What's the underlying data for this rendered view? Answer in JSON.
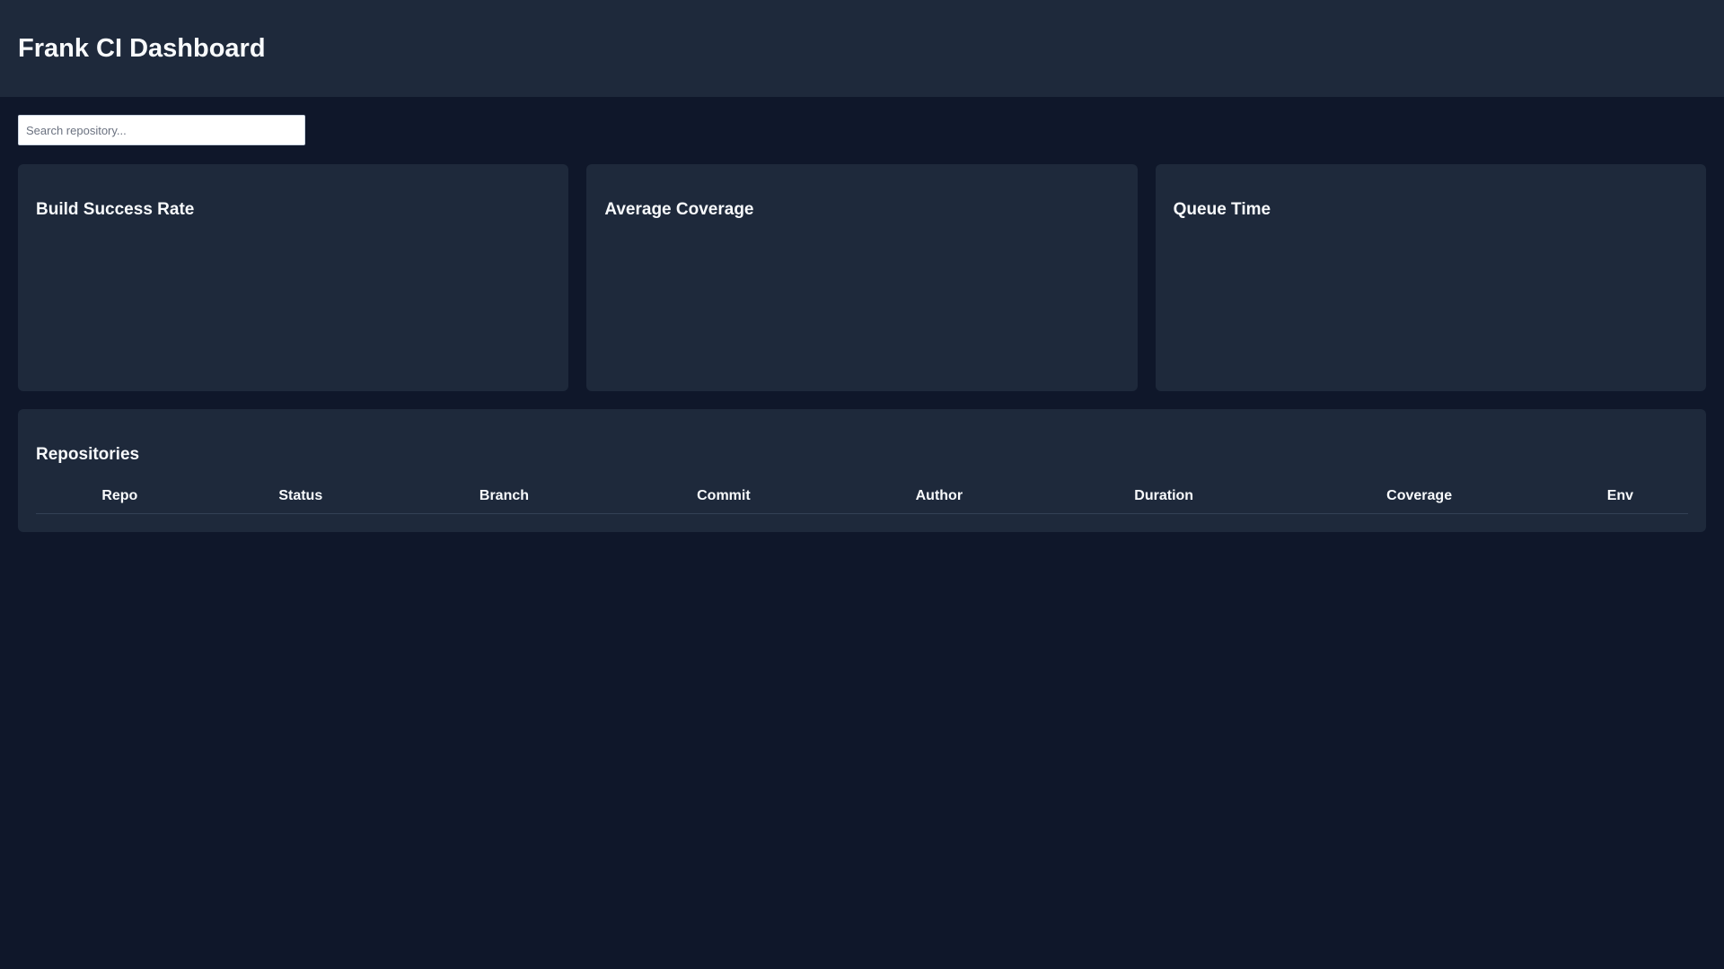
{
  "header": {
    "title": "Frank CI Dashboard"
  },
  "search": {
    "placeholder": "Search repository...",
    "value": ""
  },
  "cards": [
    {
      "title": "Build Success Rate"
    },
    {
      "title": "Average Coverage"
    },
    {
      "title": "Queue Time"
    }
  ],
  "repositories": {
    "title": "Repositories",
    "columns": [
      "Repo",
      "Status",
      "Branch",
      "Commit",
      "Author",
      "Duration",
      "Coverage",
      "Env"
    ]
  },
  "colors": {
    "background": "#0f172a",
    "panel": "#1e293b",
    "text": "#f8fafc"
  }
}
